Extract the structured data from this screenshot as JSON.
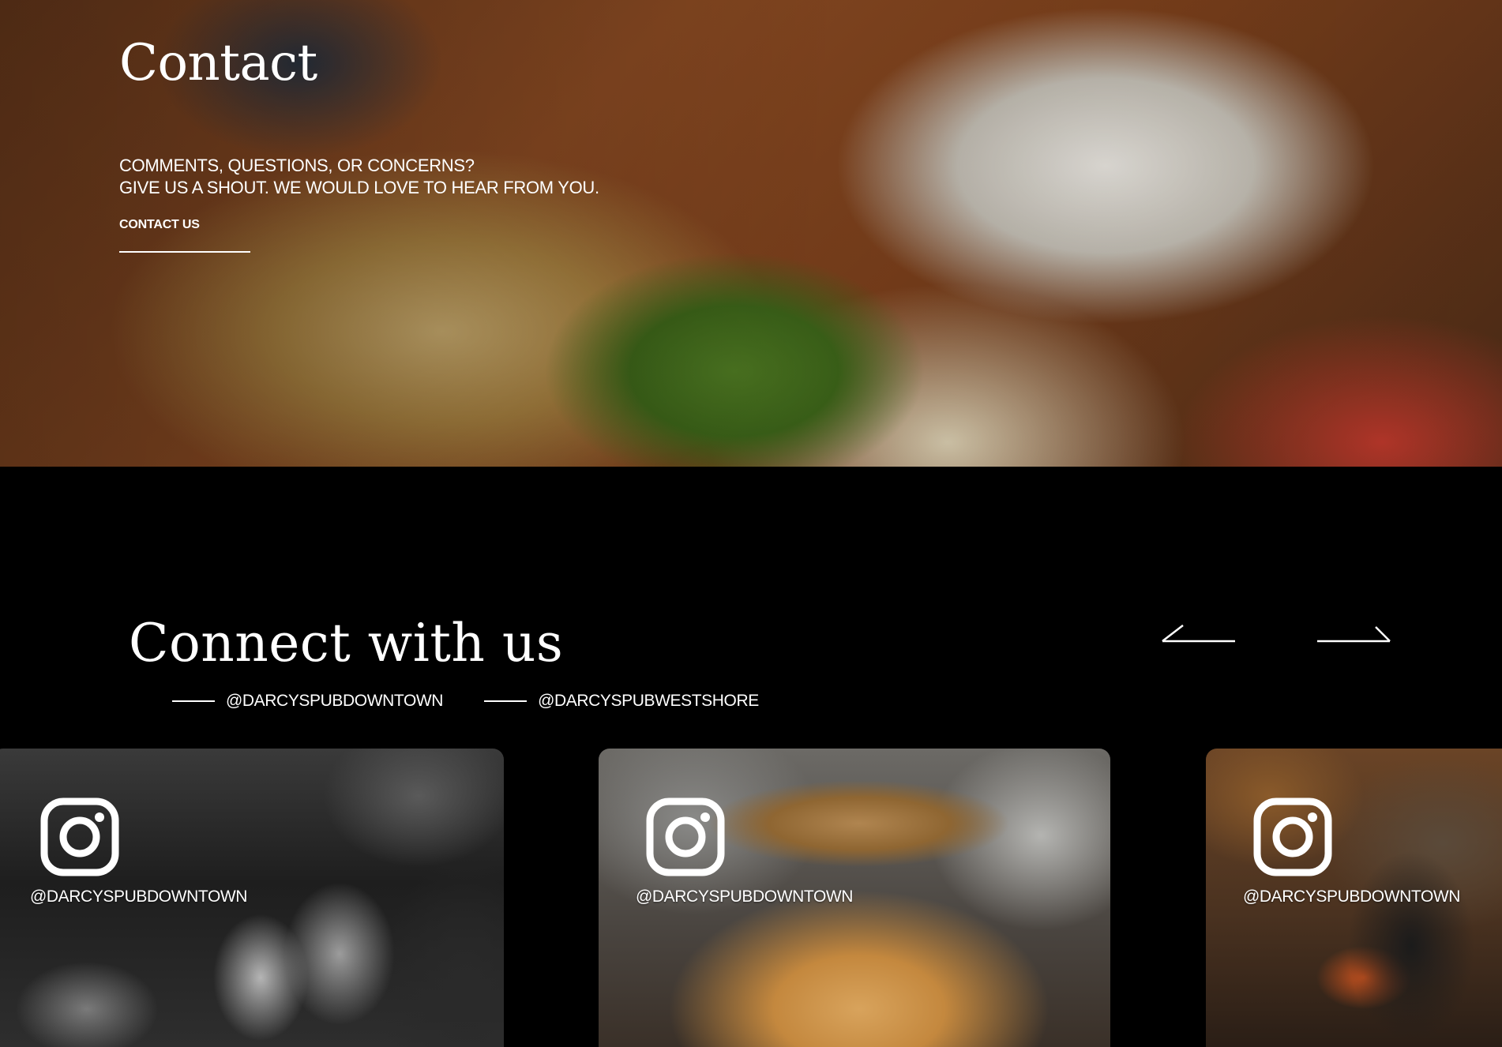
{
  "hero": {
    "title": "Contact",
    "subtitle_line1": "Comments, questions, or concerns?",
    "subtitle_line2": "Give us a shout. We would love to hear from you.",
    "cta_label": "CONTACT US"
  },
  "connect": {
    "title": "Connect with us",
    "handles": [
      {
        "label": "@DARCYSPUBDOWNTOWN"
      },
      {
        "label": "@DARCYSPUBWESTSHORE"
      }
    ],
    "prev_icon": "arrow-left-icon",
    "next_icon": "arrow-right-icon"
  },
  "cards": [
    {
      "handle": "@DARCYSPUBDOWNTOWN",
      "icon": "instagram-icon"
    },
    {
      "handle": "@DARCYSPUBDOWNTOWN",
      "icon": "instagram-icon"
    },
    {
      "handle": "@DARCYSPUBDOWNTOWN",
      "icon": "instagram-icon"
    }
  ]
}
